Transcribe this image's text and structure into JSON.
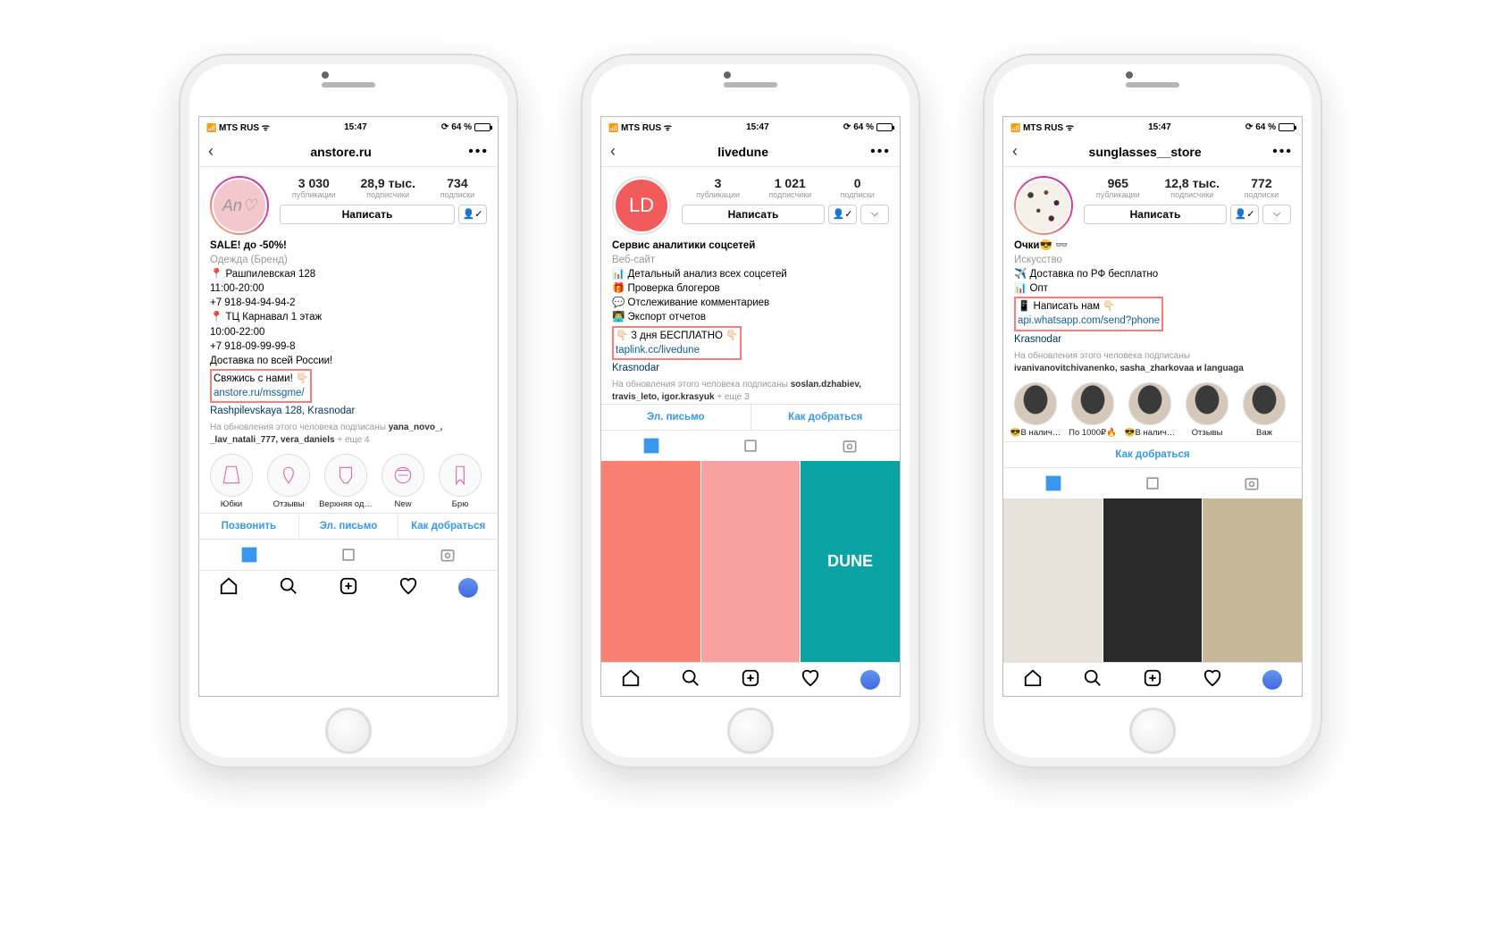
{
  "status": {
    "carrier": "MTS RUS",
    "time": "15:47",
    "battery_pct": "64 %"
  },
  "common": {
    "write_button": "Написать",
    "followed_prefix": "На обновления этого человека подписаны",
    "contact_call": "Позвонить",
    "contact_email": "Эл. письмо",
    "contact_directions": "Как добраться",
    "more": "+ еще"
  },
  "phones": [
    {
      "username": "anstore.ru",
      "avatar_text": "An♡",
      "avatar_class": "",
      "story_ring": true,
      "stats": [
        {
          "num": "3 030",
          "label": "публикации"
        },
        {
          "num": "28,9 тыс.",
          "label": "подписчики"
        },
        {
          "num": "734",
          "label": "подписки"
        }
      ],
      "bio_title": "SALE! до -50%!",
      "bio_category": "Одежда (Бренд)",
      "bio_lines": [
        "📍 Рашпилевская 128",
        "11:00-20:00",
        "+7 918-94-94-94-2",
        "📍 ТЦ Карнавал 1 этаж",
        "10:00-22:00",
        "+7 918-09-99-99-8",
        "Доставка по всей России!"
      ],
      "boxed": {
        "text": "Свяжись с нами! 👇🏻",
        "link": "anstore.ru/mssgme/"
      },
      "location": "Rashpilevskaya 128, Krasnodar",
      "followed_names": "yana_novo_, _lav_natali_777, vera_daniels",
      "followed_more": "4",
      "highlights": [
        "Юбки",
        "Отзывы",
        "Верхняя од…",
        "New",
        "Брю"
      ],
      "highlight_style": "icon",
      "contacts": [
        "Позвонить",
        "Эл. письмо",
        "Как добраться"
      ],
      "posts": []
    },
    {
      "username": "livedune",
      "avatar_text": "LD",
      "avatar_class": "ld",
      "story_ring": false,
      "stats": [
        {
          "num": "3",
          "label": "публикации"
        },
        {
          "num": "1 021",
          "label": "подписчики"
        },
        {
          "num": "0",
          "label": "подписки"
        }
      ],
      "bio_title": "Сервис аналитики соцсетей",
      "bio_category": "Веб-сайт",
      "bio_lines": [
        "📊 Детальный анализ всех соцсетей",
        "🎁 Проверка блогеров",
        "💬 Отслеживание комментариев",
        "👨‍💻 Экспорт отчетов"
      ],
      "boxed": {
        "text": "👇🏻 3 дня БЕСПЛАТНО 👇🏻",
        "link": "taplink.cc/livedune"
      },
      "location": "Krasnodar",
      "followed_names": "soslan.dzhabiev, travis_leto, igor.krasyuk",
      "followed_more": "3",
      "highlights": [],
      "contacts": [
        "Эл. письмо",
        "Как добраться"
      ],
      "posts": [
        "p1",
        "p2",
        "p3"
      ],
      "post_overlay": "DUNE"
    },
    {
      "username": "sunglasses__store",
      "avatar_text": "",
      "avatar_class": "sg",
      "story_ring": true,
      "stats": [
        {
          "num": "965",
          "label": "публикации"
        },
        {
          "num": "12,8 тыс.",
          "label": "подписчики"
        },
        {
          "num": "772",
          "label": "подписки"
        }
      ],
      "bio_title": "Очки😎 👓",
      "bio_category": "Искусство",
      "bio_lines": [
        "✈️ Доставка по РФ бесплатно",
        "📊 Опт"
      ],
      "boxed": {
        "text": "📱 Написать нам 👇🏻",
        "link": "api.whatsapp.com/send?phone"
      },
      "location": "Krasnodar",
      "followed_names": "ivanivanovitchivanenko, sasha_zharkovaa и languaga",
      "followed_more": "",
      "highlights": [
        "😎В налич…",
        "По 1000₽🔥",
        "😎В налич…",
        "Отзывы",
        "Важ"
      ],
      "highlight_style": "photo",
      "contacts": [
        "Как добраться"
      ],
      "posts": [
        "s1",
        "s2",
        "s3"
      ]
    }
  ]
}
